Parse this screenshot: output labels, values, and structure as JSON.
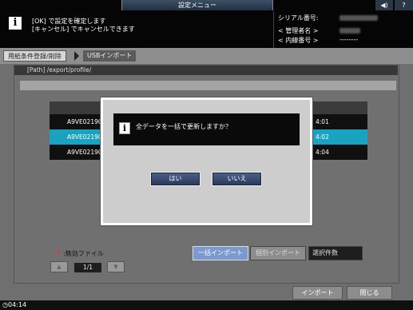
{
  "header": {
    "menu_title": "設定メニュー",
    "message_line1": "[OK] で設定を確定します",
    "message_line2": "[キャンセル] でキャンセルできます",
    "serial_label": "シリアル番号:",
    "admin_label": "< 管理者名 >",
    "extension_label": "< 内線番号 >",
    "extension_value": "--------",
    "sound_icon": "speaker-icon",
    "help_label": "?"
  },
  "breadcrumb": {
    "items": [
      "用紙条件登録/削除",
      "USBインポート"
    ]
  },
  "main": {
    "path": "[Path] /export/profile/",
    "rows": [
      {
        "name": "A9VE021901",
        "time": "4:01",
        "selected": false
      },
      {
        "name": "A9VE021901",
        "time": "4:02",
        "selected": true
      },
      {
        "name": "A9VE021901",
        "time": "4:04",
        "selected": false
      }
    ],
    "invalid_mark": "✕",
    "invalid_label": ":無効ファイル",
    "page_indicator": "1/1",
    "page_prev": "▲",
    "page_next": "▼",
    "bulk_import_label": "一括インポート",
    "individual_import_label": "個別インポート",
    "selection_count_label": "選択件数"
  },
  "footer": {
    "import_label": "インポート",
    "close_label": "閉じる",
    "time": "04:14"
  },
  "dialog": {
    "message": "全データを一括で更新しますか？",
    "yes_label": "はい",
    "no_label": "いいえ"
  }
}
